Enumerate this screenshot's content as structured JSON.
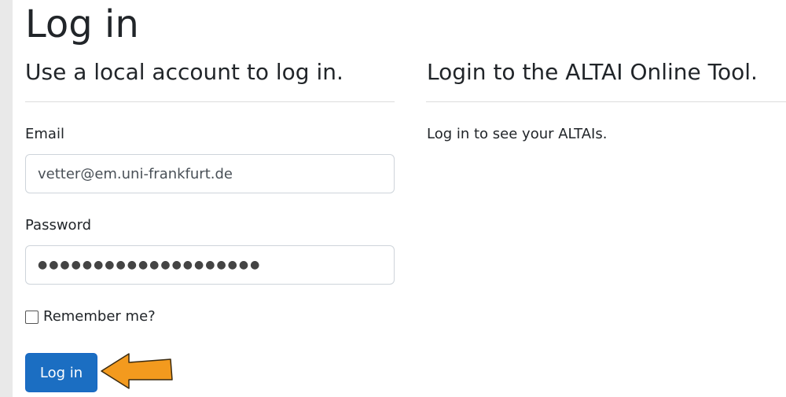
{
  "page": {
    "title": "Log in"
  },
  "left_section": {
    "heading": "Use a local account to log in.",
    "email_label": "Email",
    "email_value": "vetter@em.uni-frankfurt.de",
    "password_label": "Password",
    "password_value": "●●●●●●●●●●●●●●●●●●●●",
    "remember_label": "Remember me?",
    "remember_checked": false,
    "submit_label": "Log in"
  },
  "right_section": {
    "heading": "Login to the ALTAI Online Tool.",
    "text": "Log in to see your ALTAIs."
  },
  "annotation": {
    "icon": "arrow-left-icon",
    "color": "#f39a1e"
  },
  "colors": {
    "primary_button": "#1b6ec2",
    "background": "#e9e9e9"
  }
}
